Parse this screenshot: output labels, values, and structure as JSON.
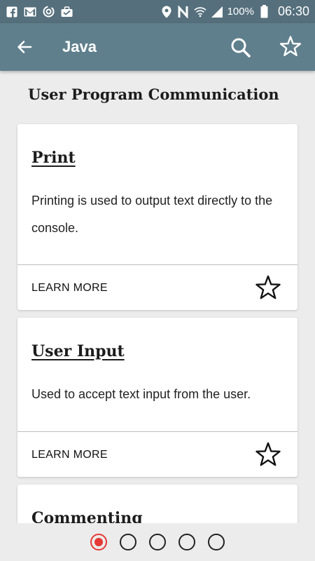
{
  "status_bar": {
    "left_icons": [
      "facebook-icon",
      "gmail-icon",
      "sync-icon",
      "briefcase-icon"
    ],
    "right_icons": [
      "location-icon",
      "nfc-icon",
      "wifi-icon",
      "signal-icon",
      "battery-icon"
    ],
    "battery": "100%",
    "time": "06:30"
  },
  "app_bar": {
    "title": "Java",
    "icons": [
      "arrow-back-icon",
      "search-icon",
      "star-outline-icon"
    ],
    "color": "#5f7f8d"
  },
  "section_title": "User Program Communication",
  "cards": [
    {
      "title": "Print",
      "description": "Printing is used to output text directly to the console.",
      "action": "LEARN MORE",
      "icon": "star-outline-icon"
    },
    {
      "title": "User Input",
      "description": "Used to accept text input from the user.",
      "action": "LEARN MORE",
      "icon": "star-outline-icon"
    },
    {
      "title": "Commenting"
    }
  ],
  "pagination": {
    "pages": 5,
    "current": 1,
    "active_color": "#e53935"
  }
}
